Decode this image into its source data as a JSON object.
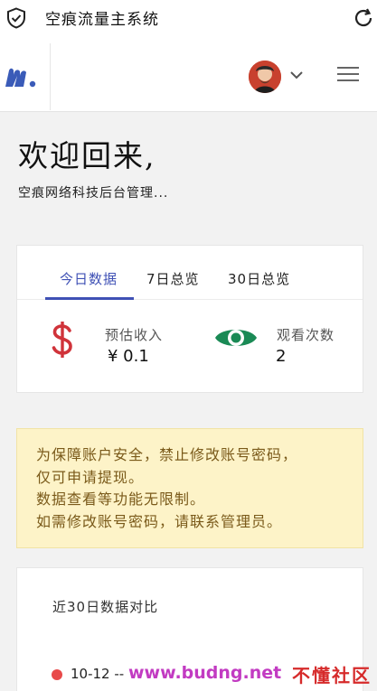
{
  "app": {
    "window_title": "空痕流量主系统"
  },
  "welcome": {
    "heading": "欢迎回来,",
    "subtitle": "空痕网络科技后台管理..."
  },
  "stats": {
    "tabs": [
      {
        "label": "今日数据",
        "active": true
      },
      {
        "label": "7日总览",
        "active": false
      },
      {
        "label": "30日总览",
        "active": false
      }
    ],
    "income_label": "预估收入",
    "income_value": "¥  0.1",
    "views_label": "观看次数",
    "views_value": "2",
    "colors": {
      "income_icon": "#d0333a",
      "views_icon": "#1a8a55",
      "accent": "#3f51b5"
    }
  },
  "notice": {
    "lines": [
      "为保障账户安全，禁止修改账号密码，",
      "仅可申请提现。",
      "数据查看等功能无限制。",
      "如需修改账号密码，请联系管理员。"
    ]
  },
  "compare": {
    "title": "近30日数据对比",
    "first_range": "10-12 -- "
  },
  "watermark": {
    "text1": "www.budng.net",
    "text2": "不懂社区"
  }
}
